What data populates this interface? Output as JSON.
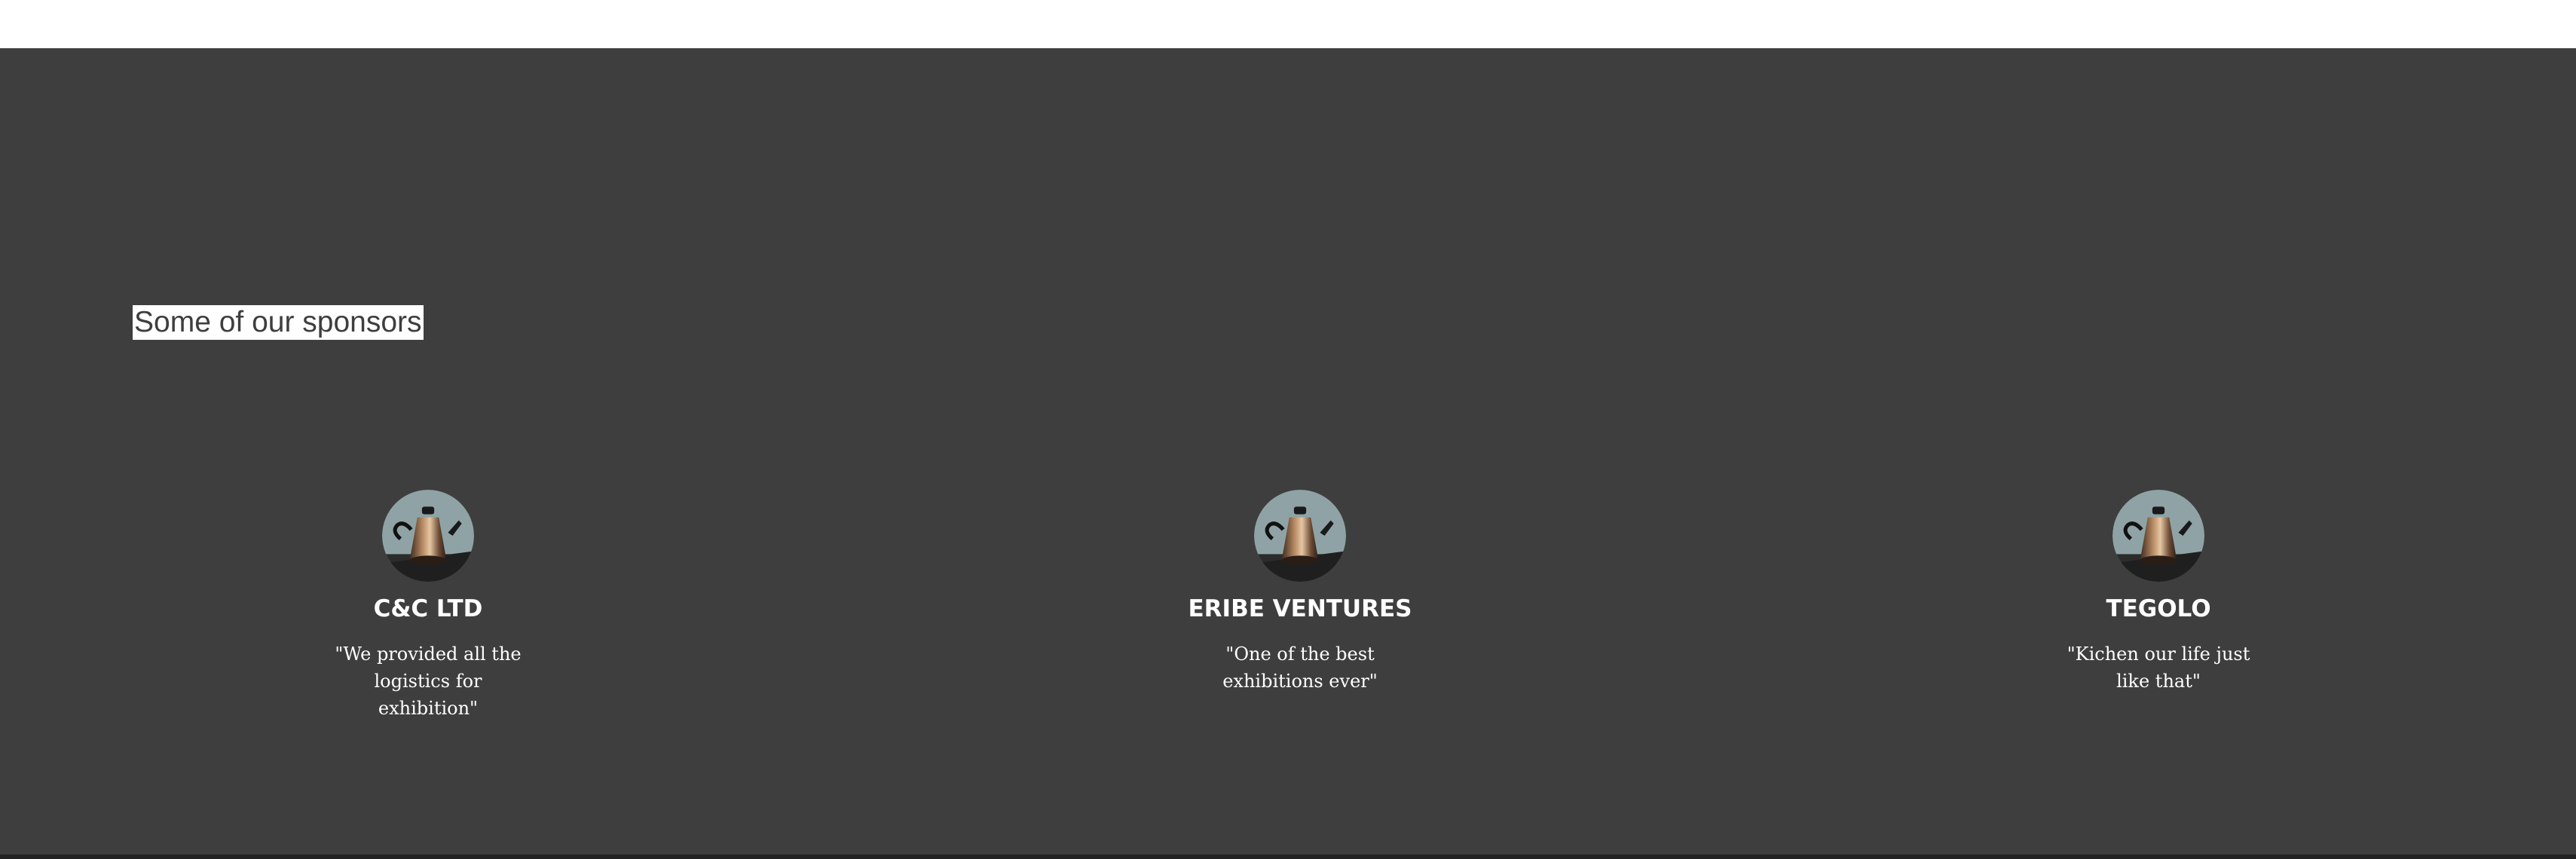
{
  "section": {
    "title": "Some of our sponsors"
  },
  "sponsors": [
    {
      "name": "C&C LTD",
      "quote": "\"We provided all the logistics for exhibition\"",
      "avatar_icon": "coffee-kettle-image"
    },
    {
      "name": "ERIBE VENTURES",
      "quote": "\"One of the best exhibitions ever\"",
      "avatar_icon": "coffee-kettle-image"
    },
    {
      "name": "TEGOLO",
      "quote": "\"Kichen our life just like that\"",
      "avatar_icon": "coffee-kettle-image"
    }
  ],
  "colors": {
    "section_background": "#3e3e3e",
    "title_highlight": "#ffffff",
    "text": "#ffffff",
    "bottom_strip": "#222222"
  }
}
